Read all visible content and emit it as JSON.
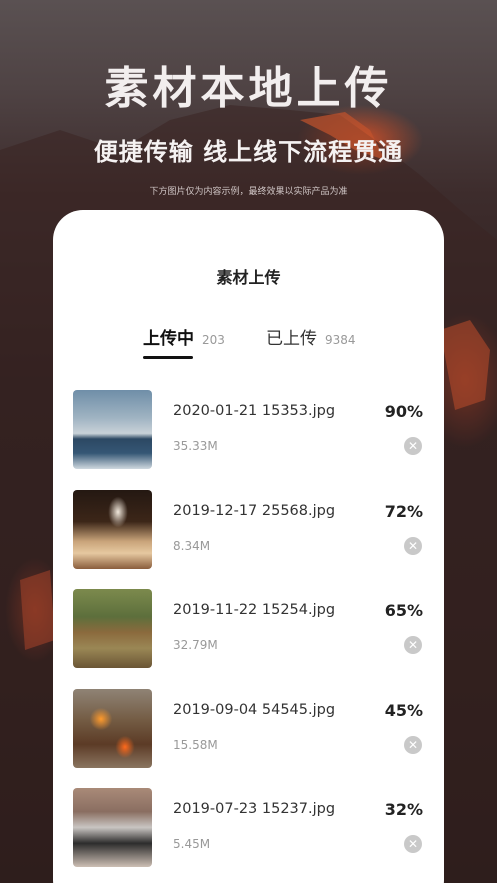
{
  "hero": {
    "title": "素材本地上传",
    "subtitle": "便捷传输 线上线下流程贯通",
    "note": "下方图片仅为内容示例，最终效果以实际产品为准"
  },
  "card": {
    "title": "素材上传",
    "tabs": [
      {
        "label": "上传中",
        "count": "203"
      },
      {
        "label": "已上传",
        "count": "9384"
      }
    ]
  },
  "files": [
    {
      "name": "2020-01-21 15353.jpg",
      "size": "35.33M",
      "progress": "90%",
      "thumb": "seascape-image"
    },
    {
      "name": "2019-12-17 25568.jpg",
      "size": "8.34M",
      "progress": "72%",
      "thumb": "concert-crowd-image"
    },
    {
      "name": "2019-11-22 15254.jpg",
      "size": "32.79M",
      "progress": "65%",
      "thumb": "house-field-image"
    },
    {
      "name": "2019-09-04 54545.jpg",
      "size": "15.58M",
      "progress": "45%",
      "thumb": "burning-house-image"
    },
    {
      "name": "2019-07-23 15237.jpg",
      "size": "5.45M",
      "progress": "32%",
      "thumb": "phone-photo-image"
    }
  ],
  "icons": {
    "cancel": "close-circle-icon"
  },
  "colors": {
    "accent": "#111111",
    "background": "#3b2b2b",
    "card": "#ffffff"
  }
}
